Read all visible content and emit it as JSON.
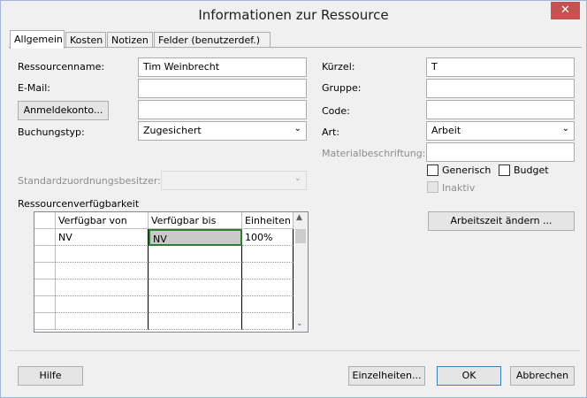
{
  "window": {
    "title": "Informationen zur Ressource",
    "close_glyph": "✕"
  },
  "tabs": [
    "Allgemein",
    "Kosten",
    "Notizen",
    "Felder (benutzerdef.)"
  ],
  "left": {
    "name_label": "Ressourcenname:",
    "name_value": "Tim Weinbrecht",
    "email_label": "E-Mail:",
    "email_value": "",
    "account_button": "Anmeldekonto...",
    "account_value": "",
    "booking_label": "Buchungstyp:",
    "booking_value": "Zugesichert",
    "owner_label": "Standardzuordnungsbesitzer:",
    "owner_value": ""
  },
  "right": {
    "initials_label": "Kürzel:",
    "initials_value": "T",
    "group_label": "Gruppe:",
    "group_value": "",
    "code_label": "Code:",
    "code_value": "",
    "type_label": "Art:",
    "type_value": "Arbeit",
    "material_label": "Materialbeschriftung:",
    "material_value": "",
    "generic_label": "Generisch",
    "budget_label": "Budget",
    "inactive_label": "Inaktiv",
    "change_time_button": "Arbeitszeit ändern ..."
  },
  "availability": {
    "section_label": "Ressourcenverfügbarkeit",
    "columns": [
      "Verfügbar von",
      "Verfügbar bis",
      "Einheiten"
    ],
    "rows": [
      [
        "NV",
        "NV",
        "100%"
      ]
    ],
    "empty_rows": 5
  },
  "footer": {
    "help_button": "Hilfe",
    "details_button": "Einzelheiten...",
    "ok_button": "OK",
    "cancel_button": "Abbrechen"
  },
  "colors": {
    "accent_border": "#9fb6d8",
    "close_red": "#c75050",
    "selected_cell_bg": "#c9c9c9",
    "selected_cell_border": "#2f7d32"
  }
}
